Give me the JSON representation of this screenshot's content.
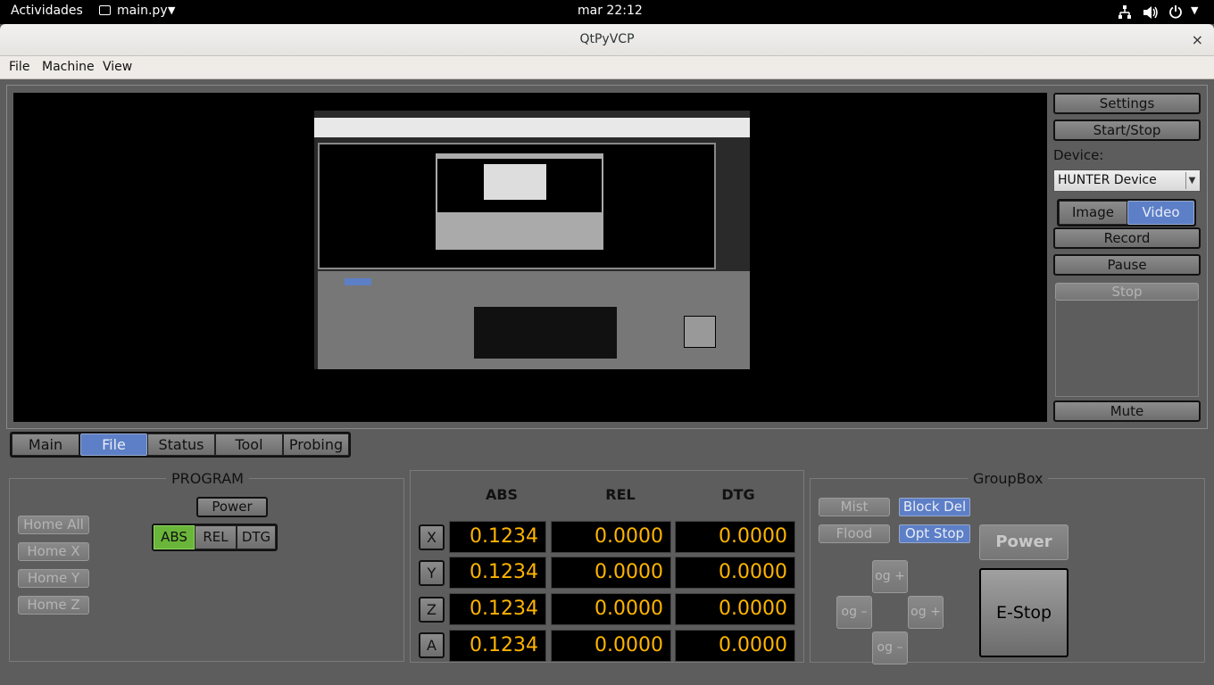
{
  "system": {
    "activities": "Actividades",
    "app_menu": "main.py",
    "clock": "mar 22:12"
  },
  "window": {
    "title": "QtPyVCP",
    "close": "×"
  },
  "menu": [
    "File",
    "Machine",
    "View"
  ],
  "camera": {
    "settings": "Settings",
    "start_stop": "Start/Stop",
    "device_label": "Device:",
    "device_value": "HUNTER Device",
    "image": "Image",
    "video": "Video",
    "record": "Record",
    "pause": "Pause",
    "stop": "Stop",
    "mute": "Mute"
  },
  "tabs": [
    {
      "label": "Main",
      "active": false
    },
    {
      "label": "File",
      "active": true
    },
    {
      "label": "Status",
      "active": false
    },
    {
      "label": "Tool",
      "active": false
    },
    {
      "label": "Probing",
      "active": false
    }
  ],
  "program": {
    "title": "PROGRAM",
    "power": "Power",
    "home_buttons": [
      "Home All",
      "Home X",
      "Home Y",
      "Home Z"
    ],
    "modes": [
      "ABS",
      "REL",
      "DTG"
    ],
    "active_mode": "ABS"
  },
  "dro": {
    "headers": [
      "ABS",
      "REL",
      "DTG"
    ],
    "rows": [
      {
        "axis": "X",
        "abs": "0.1234",
        "rel": "0.0000",
        "dtg": "0.0000"
      },
      {
        "axis": "Y",
        "abs": "0.1234",
        "rel": "0.0000",
        "dtg": "0.0000"
      },
      {
        "axis": "Z",
        "abs": "0.1234",
        "rel": "0.0000",
        "dtg": "0.0000"
      },
      {
        "axis": "A",
        "abs": "0.1234",
        "rel": "0.0000",
        "dtg": "0.0000"
      }
    ]
  },
  "groupbox": {
    "title": "GroupBox",
    "mist": "Mist",
    "block_del": "Block Del",
    "flood": "Flood",
    "opt_stop": "Opt Stop",
    "power": "Power",
    "estop": "E-Stop",
    "jog_up": "og +",
    "jog_left": "og –",
    "jog_right": "og +",
    "jog_down": "og –"
  },
  "colors": {
    "accent_blue": "#5d7fc7",
    "active_green": "#6ab63a",
    "dro_text": "#ffb400"
  }
}
